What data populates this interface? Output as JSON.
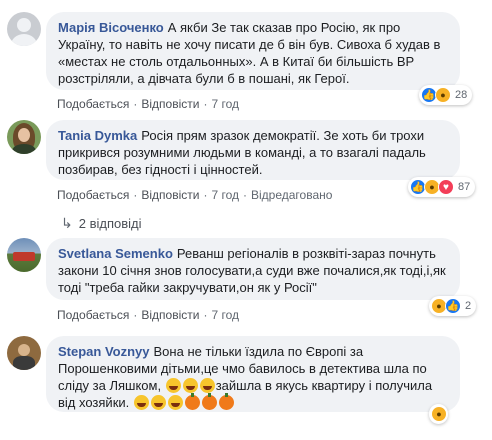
{
  "comments": [
    {
      "author": "Марія Вісоченко",
      "text": "А якби Зе так сказав про Росію, як про Україну, то навіть не хочу писати де б він був. Сивоха б худав в «местах не столь отдальонных». А в Китаї би більшість ВР розстріляли, а дівчата були б в пошані, як Герої.",
      "reaction_count": "28",
      "reactions": [
        "like",
        "wow"
      ],
      "actions": {
        "like": "Подобається",
        "reply": "Відповісти",
        "time": "7 год"
      }
    },
    {
      "author": "Tania Dymka",
      "text": "Росія прям зразок демократії. Зе хоть би трохи прикрився розумними людьми в команді, а то взагалі падаль позбирав, без гідності і цінностей.",
      "reaction_count": "87",
      "reactions": [
        "like",
        "wow",
        "love"
      ],
      "actions": {
        "like": "Подобається",
        "reply": "Відповісти",
        "time": "7 год",
        "edited": "Відредаговано"
      },
      "replies_label": "2 відповіді"
    },
    {
      "author": "Svetlana Semenko",
      "text": "Реванш регіоналів в розквіті-зараз почнуть закони 10 січня знов голосувати,а суди вже почалися,як тоді,і,як тоді \"треба гайки закручувати,он як у Росії\"",
      "reaction_count": "2",
      "reactions": [
        "wow",
        "like"
      ],
      "actions": {
        "like": "Подобається",
        "reply": "Відповісти",
        "time": "7 год"
      }
    },
    {
      "author": "Stepan Voznyy",
      "text_part1": "Вона не тільки їздила по Європі за Порошенковими дітьми,це чмо бавилось в детектива шла по сліду за Ляшком,",
      "text_part2": "зайшла в якусь квартиру і получила від хозяйки.",
      "reactions": [
        "wow"
      ],
      "reaction_count": ""
    }
  ],
  "colors": {
    "author": "#385898",
    "bubble_bg": "#f0f2f5",
    "meta": "#606770",
    "like": "#1877f2",
    "love": "#f33e58",
    "wow": "#f7b125"
  }
}
